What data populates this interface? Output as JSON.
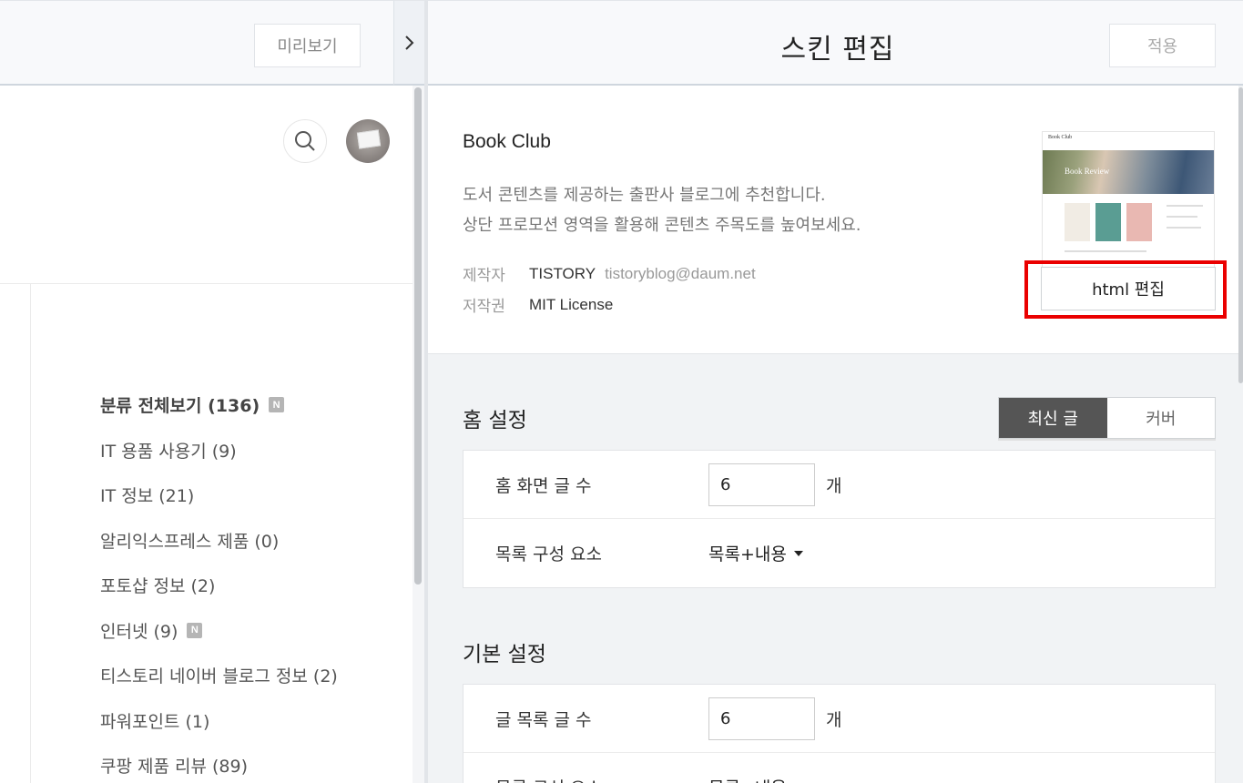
{
  "preview": {
    "preview_button": "미리보기",
    "categories": [
      {
        "label": "분류 전체보기 (136)",
        "badge": "N",
        "bold": true
      },
      {
        "label": "IT 용품 사용기 (9)"
      },
      {
        "label": "IT 정보 (21)"
      },
      {
        "label": "알리익스프레스 제품 (0)"
      },
      {
        "label": "포토샵 정보 (2)"
      },
      {
        "label": "인터넷 (9)",
        "badge": "N"
      },
      {
        "label": "티스토리 네이버 블로그 정보 (2)"
      },
      {
        "label": "파워포인트 (1)"
      },
      {
        "label": "쿠팡 제품 리뷰 (89)"
      }
    ]
  },
  "editor": {
    "title": "스킨 편집",
    "apply_button": "적용",
    "skin": {
      "name": "Book Club",
      "description_line1": "도서 콘텐츠를 제공하는 출판사 블로그에 추천합니다.",
      "description_line2": "상단 프로모션 영역을 활용해 콘텐츠 주목도를 높여보세요.",
      "maker_label": "제작자",
      "maker_value": "TISTORY",
      "maker_email": "tistoryblog@daum.net",
      "license_label": "저작권",
      "license_value": "MIT License",
      "thumbnail_logo": "Book Club",
      "thumbnail_hero": "Book Review",
      "html_edit_button": "html 편집"
    },
    "home_settings": {
      "title": "홈 설정",
      "tab_latest": "최신 글",
      "tab_cover": "커버",
      "rows": {
        "post_count_label": "홈 화면 글 수",
        "post_count_value": "6",
        "post_count_unit": "개",
        "list_component_label": "목록 구성 요소",
        "list_component_value": "목록+내용"
      }
    },
    "basic_settings": {
      "title": "기본 설정",
      "rows": {
        "post_list_count_label": "글 목록 글 수",
        "post_list_count_value": "6",
        "post_list_count_unit": "개",
        "list_component_label": "목록 구성 요소",
        "list_component_value": "목록+내용"
      }
    }
  },
  "colors": {
    "highlight": "#ea0000",
    "active_tab": "#555555",
    "panel_bg": "#f1f3f5"
  }
}
